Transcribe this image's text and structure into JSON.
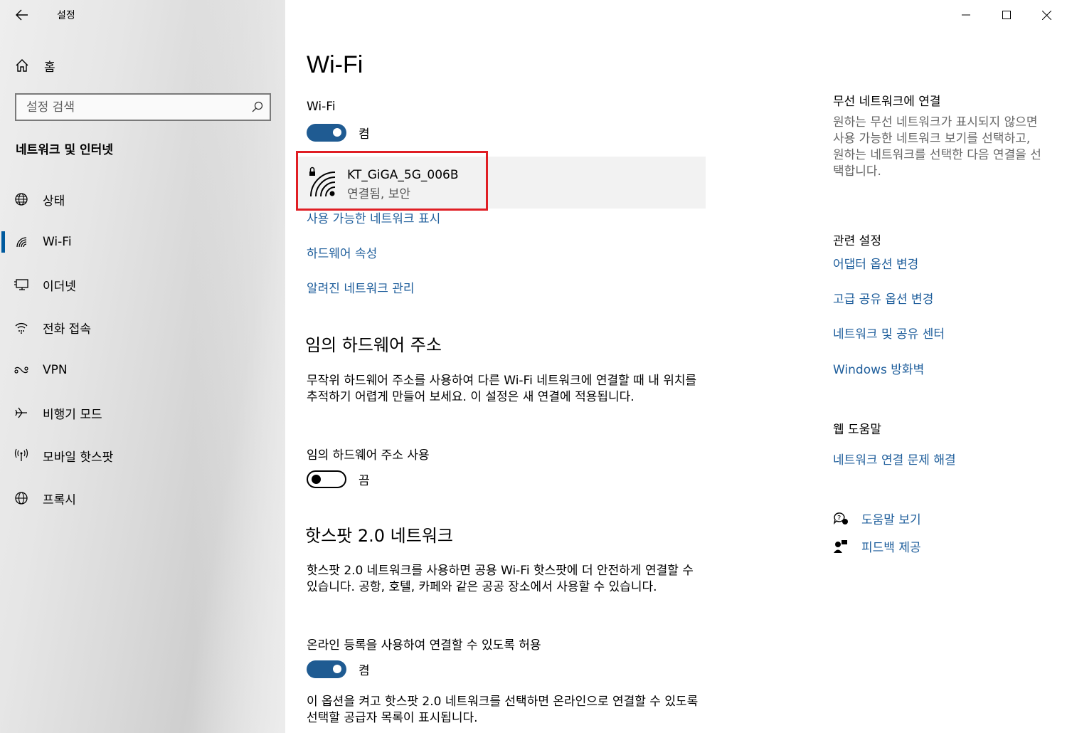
{
  "app": {
    "title": "설정"
  },
  "sidebar": {
    "home_label": "홈",
    "search_placeholder": "설정 검색",
    "section_title": "네트워크 및 인터넷",
    "items": [
      {
        "label": "상태",
        "icon": "globe-status-icon"
      },
      {
        "label": "Wi-Fi",
        "icon": "wifi-icon",
        "selected": true
      },
      {
        "label": "이더넷",
        "icon": "ethernet-icon"
      },
      {
        "label": "전화 접속",
        "icon": "dialup-icon"
      },
      {
        "label": "VPN",
        "icon": "vpn-icon"
      },
      {
        "label": "비행기 모드",
        "icon": "airplane-icon"
      },
      {
        "label": "모바일 핫스팟",
        "icon": "hotspot-icon"
      },
      {
        "label": "프록시",
        "icon": "globe-icon"
      }
    ]
  },
  "main": {
    "title": "Wi-Fi",
    "wifi_label": "Wi-Fi",
    "wifi_toggle": {
      "state": "on",
      "text": "켬"
    },
    "network": {
      "name": "KT_GiGA_5G_006B",
      "status": "연결됨, 보안"
    },
    "links": {
      "show_available": "사용 가능한 네트워크 표시",
      "hardware_props": "하드웨어 속성",
      "manage_known": "알려진 네트워크 관리"
    },
    "random_hw": {
      "heading": "임의 하드웨어 주소",
      "desc": "무작위 하드웨어 주소를 사용하여 다른 Wi-Fi 네트워크에 연결할 때 내 위치를 추적하기 어렵게 만들어 보세요. 이 설정은 새 연결에 적용됩니다.",
      "toggle_label": "임의 하드웨어 주소 사용",
      "toggle": {
        "state": "off",
        "text": "끔"
      }
    },
    "hotspot20": {
      "heading": "핫스팟 2.0 네트워크",
      "desc": "핫스팟 2.0 네트워크를 사용하면 공용 Wi-Fi 핫스팟에 더 안전하게 연결할 수 있습니다. 공항, 호텔, 카페와 같은 공공 장소에서 사용할 수 있습니다.",
      "toggle_label": "온라인 등록을 사용하여 연결할 수 있도록 허용",
      "toggle": {
        "state": "on",
        "text": "켬"
      },
      "note": "이 옵션을 켜고 핫스팟 2.0 네트워크를 선택하면 온라인으로 연결할 수 있도록 선택할 공급자 목록이 표시됩니다."
    }
  },
  "right": {
    "connect_heading": "무선 네트워크에 연결",
    "connect_desc": "원하는 무선 네트워크가 표시되지 않으면 사용 가능한 네트워크 보기를 선택하고, 원하는 네트워크를 선택한 다음 연결을 선택합니다.",
    "related_heading": "관련 설정",
    "related_links": [
      "어댑터 옵션 변경",
      "고급 공유 옵션 변경",
      "네트워크 및 공유 센터",
      "Windows 방화벽"
    ],
    "web_help_heading": "웹 도움말",
    "web_help_link": "네트워크 연결 문제 해결",
    "help_link": "도움말 보기",
    "feedback_link": "피드백 제공"
  },
  "colors": {
    "accent": "#1f5b92",
    "link": "#1d5d9b",
    "highlight": "#e01e24"
  }
}
